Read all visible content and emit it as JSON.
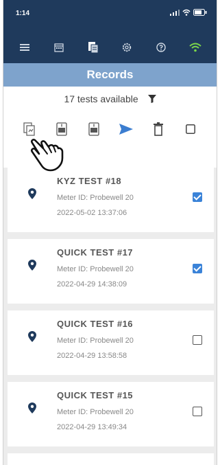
{
  "status": {
    "time": "1:14"
  },
  "header": {
    "title": "Records"
  },
  "toolbar": {
    "count_text": "17 tests available"
  },
  "records": [
    {
      "title": "KYZ TEST #18",
      "meter": "Meter ID: Probewell 20",
      "date": "2022-05-02 13:37:06",
      "checked": true
    },
    {
      "title": "QUICK TEST #17",
      "meter": "Meter ID: Probewell 20",
      "date": "2022-04-29 14:38:09",
      "checked": true
    },
    {
      "title": "QUICK TEST #16",
      "meter": "Meter ID: Probewell 20",
      "date": "2022-04-29 13:58:58",
      "checked": false
    },
    {
      "title": "QUICK TEST #15",
      "meter": "Meter ID: Probewell 20",
      "date": "2022-04-29 13:49:34",
      "checked": false
    }
  ],
  "colors": {
    "navbar": "#1f3a5c",
    "titlebar": "#7ea3cc",
    "accent": "#3b83d8",
    "wifi": "#7bd64a"
  },
  "icons": [
    "menu-icon",
    "calendar-icon",
    "records-icon",
    "settings-icon",
    "help-icon",
    "wifi-icon",
    "filter-icon",
    "report-icon",
    "export-a-icon",
    "export-b-icon",
    "send-icon",
    "trash-icon",
    "select-all-checkbox",
    "location-pin-icon",
    "pointer-hand-icon"
  ]
}
